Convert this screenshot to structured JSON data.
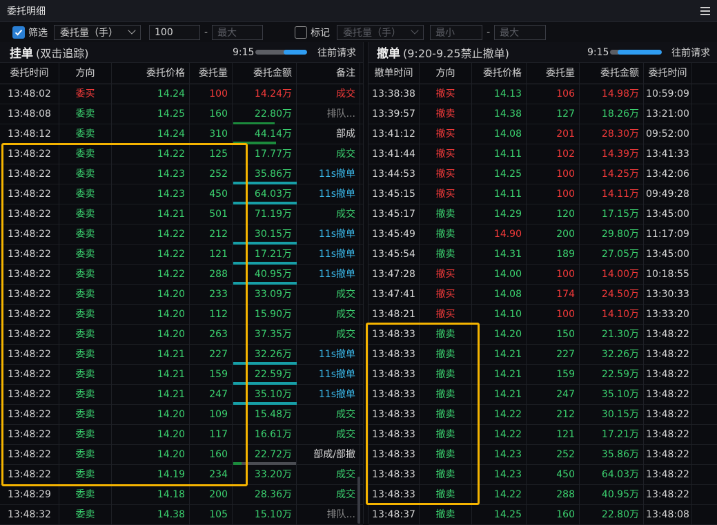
{
  "window": {
    "title": "委托明细",
    "menu_icon": "hamburger-menu-icon"
  },
  "filter": {
    "filter_checked": true,
    "filter_label": "筛选",
    "field_select": "委托量（手）",
    "min_value": "100",
    "dash": "-",
    "max_placeholder": "最大",
    "mark_checked": false,
    "mark_label": "标记",
    "mark_select": "委托量（手）",
    "mark_min_placeholder": "最小",
    "mark_max_placeholder": "最大"
  },
  "left": {
    "title": "挂单",
    "subtitle": "(双击追踪)",
    "time": "9:15",
    "progress": 0.45,
    "request": "往前请求",
    "columns": [
      "委托时间",
      "方向",
      "委托价格",
      "委托量",
      "委托金额",
      "备注"
    ],
    "rows": [
      {
        "time": "13:48:02",
        "dir": "委买",
        "price": "14.24",
        "vol": "100",
        "amt": "14.24万",
        "note": "成交",
        "dc": "red",
        "pc": "grn",
        "vc": "red",
        "ac": "red",
        "nc": "red",
        "bar": "none"
      },
      {
        "time": "13:48:08",
        "dir": "委卖",
        "price": "14.25",
        "vol": "160",
        "amt": "22.80万",
        "note": "排队...",
        "dc": "grn",
        "pc": "grn",
        "vc": "grn",
        "ac": "grn",
        "nc": "gray",
        "bar": "gray"
      },
      {
        "time": "13:48:12",
        "dir": "委卖",
        "price": "14.24",
        "vol": "310",
        "amt": "44.14万",
        "note": "部成",
        "dc": "grn",
        "pc": "grn",
        "vc": "grn",
        "ac": "grn",
        "nc": "wht",
        "bar": "green"
      },
      {
        "time": "13:48:22",
        "dir": "委卖",
        "price": "14.22",
        "vol": "125",
        "amt": "17.77万",
        "note": "成交",
        "dc": "grn",
        "pc": "grn",
        "vc": "grn",
        "ac": "grn",
        "nc": "grn",
        "bar": "none"
      },
      {
        "time": "13:48:22",
        "dir": "委卖",
        "price": "14.23",
        "vol": "252",
        "amt": "35.86万",
        "note": "11s撤单",
        "dc": "grn",
        "pc": "grn",
        "vc": "grn",
        "ac": "grn",
        "nc": "cyan",
        "bar": "teal"
      },
      {
        "time": "13:48:22",
        "dir": "委卖",
        "price": "14.23",
        "vol": "450",
        "amt": "64.03万",
        "note": "11s撤单",
        "dc": "grn",
        "pc": "grn",
        "vc": "grn",
        "ac": "grn",
        "nc": "cyan",
        "bar": "teal"
      },
      {
        "time": "13:48:22",
        "dir": "委卖",
        "price": "14.21",
        "vol": "501",
        "amt": "71.19万",
        "note": "成交",
        "dc": "grn",
        "pc": "grn",
        "vc": "grn",
        "ac": "grn",
        "nc": "grn",
        "bar": "none"
      },
      {
        "time": "13:48:22",
        "dir": "委卖",
        "price": "14.22",
        "vol": "212",
        "amt": "30.15万",
        "note": "11s撤单",
        "dc": "grn",
        "pc": "grn",
        "vc": "grn",
        "ac": "grn",
        "nc": "cyan",
        "bar": "teal"
      },
      {
        "time": "13:48:22",
        "dir": "委卖",
        "price": "14.22",
        "vol": "121",
        "amt": "17.21万",
        "note": "11s撤单",
        "dc": "grn",
        "pc": "grn",
        "vc": "grn",
        "ac": "grn",
        "nc": "cyan",
        "bar": "teal"
      },
      {
        "time": "13:48:22",
        "dir": "委卖",
        "price": "14.22",
        "vol": "288",
        "amt": "40.95万",
        "note": "11s撤单",
        "dc": "grn",
        "pc": "grn",
        "vc": "grn",
        "ac": "grn",
        "nc": "cyan",
        "bar": "teal"
      },
      {
        "time": "13:48:22",
        "dir": "委卖",
        "price": "14.20",
        "vol": "233",
        "amt": "33.09万",
        "note": "成交",
        "dc": "grn",
        "pc": "grn",
        "vc": "grn",
        "ac": "grn",
        "nc": "grn",
        "bar": "none"
      },
      {
        "time": "13:48:22",
        "dir": "委卖",
        "price": "14.20",
        "vol": "112",
        "amt": "15.90万",
        "note": "成交",
        "dc": "grn",
        "pc": "grn",
        "vc": "grn",
        "ac": "grn",
        "nc": "grn",
        "bar": "none"
      },
      {
        "time": "13:48:22",
        "dir": "委卖",
        "price": "14.20",
        "vol": "263",
        "amt": "37.35万",
        "note": "成交",
        "dc": "grn",
        "pc": "grn",
        "vc": "grn",
        "ac": "grn",
        "nc": "grn",
        "bar": "none"
      },
      {
        "time": "13:48:22",
        "dir": "委卖",
        "price": "14.21",
        "vol": "227",
        "amt": "32.26万",
        "note": "11s撤单",
        "dc": "grn",
        "pc": "grn",
        "vc": "grn",
        "ac": "grn",
        "nc": "cyan",
        "bar": "teal"
      },
      {
        "time": "13:48:22",
        "dir": "委卖",
        "price": "14.21",
        "vol": "159",
        "amt": "22.59万",
        "note": "11s撤单",
        "dc": "grn",
        "pc": "grn",
        "vc": "grn",
        "ac": "grn",
        "nc": "cyan",
        "bar": "teal"
      },
      {
        "time": "13:48:22",
        "dir": "委卖",
        "price": "14.21",
        "vol": "247",
        "amt": "35.10万",
        "note": "11s撤单",
        "dc": "grn",
        "pc": "grn",
        "vc": "grn",
        "ac": "grn",
        "nc": "cyan",
        "bar": "teal"
      },
      {
        "time": "13:48:22",
        "dir": "委卖",
        "price": "14.20",
        "vol": "109",
        "amt": "15.48万",
        "note": "成交",
        "dc": "grn",
        "pc": "grn",
        "vc": "grn",
        "ac": "grn",
        "nc": "grn",
        "bar": "none"
      },
      {
        "time": "13:48:22",
        "dir": "委卖",
        "price": "14.20",
        "vol": "117",
        "amt": "16.61万",
        "note": "成交",
        "dc": "grn",
        "pc": "grn",
        "vc": "grn",
        "ac": "grn",
        "nc": "grn",
        "bar": "none"
      },
      {
        "time": "13:48:22",
        "dir": "委卖",
        "price": "14.20",
        "vol": "160",
        "amt": "22.72万",
        "note": "部成/部撤",
        "dc": "grn",
        "pc": "grn",
        "vc": "grn",
        "ac": "grn",
        "nc": "wht",
        "bar": "mixed"
      },
      {
        "time": "13:48:22",
        "dir": "委卖",
        "price": "14.19",
        "vol": "234",
        "amt": "33.20万",
        "note": "成交",
        "dc": "grn",
        "pc": "grn",
        "vc": "grn",
        "ac": "grn",
        "nc": "grn",
        "bar": "none"
      },
      {
        "time": "13:48:29",
        "dir": "委卖",
        "price": "14.18",
        "vol": "200",
        "amt": "28.36万",
        "note": "成交",
        "dc": "grn",
        "pc": "grn",
        "vc": "grn",
        "ac": "grn",
        "nc": "grn",
        "bar": "none"
      },
      {
        "time": "13:48:32",
        "dir": "委卖",
        "price": "14.38",
        "vol": "105",
        "amt": "15.10万",
        "note": "排队...",
        "dc": "grn",
        "pc": "grn",
        "vc": "grn",
        "ac": "grn",
        "nc": "gray",
        "bar": "none"
      }
    ]
  },
  "right": {
    "title": "撤单",
    "subtitle": "(9:20-9.25禁止撤单)",
    "time": "9:15",
    "progress": 0.85,
    "request": "往前请求",
    "columns": [
      "撤单时间",
      "方向",
      "委托价格",
      "委托量",
      "委托金额",
      "委托时间"
    ],
    "rows": [
      {
        "time": "13:38:38",
        "dir": "撤买",
        "price": "14.13",
        "vol": "106",
        "amt": "14.98万",
        "otime": "10:59:09",
        "dc": "red",
        "pc": "grn",
        "vc": "red",
        "ac": "red"
      },
      {
        "time": "13:39:57",
        "dir": "撤卖",
        "price": "14.38",
        "vol": "127",
        "amt": "18.26万",
        "otime": "13:21:00",
        "dc": "red",
        "pc": "grn",
        "vc": "grn",
        "ac": "grn"
      },
      {
        "time": "13:41:12",
        "dir": "撤买",
        "price": "14.08",
        "vol": "201",
        "amt": "28.30万",
        "otime": "09:52:00",
        "dc": "red",
        "pc": "grn",
        "vc": "red",
        "ac": "red"
      },
      {
        "time": "13:41:44",
        "dir": "撤买",
        "price": "14.11",
        "vol": "102",
        "amt": "14.39万",
        "otime": "13:41:33",
        "dc": "red",
        "pc": "grn",
        "vc": "red",
        "ac": "red"
      },
      {
        "time": "13:44:53",
        "dir": "撤买",
        "price": "14.25",
        "vol": "100",
        "amt": "14.25万",
        "otime": "13:42:06",
        "dc": "red",
        "pc": "grn",
        "vc": "red",
        "ac": "red"
      },
      {
        "time": "13:45:15",
        "dir": "撤买",
        "price": "14.11",
        "vol": "100",
        "amt": "14.11万",
        "otime": "09:49:28",
        "dc": "red",
        "pc": "grn",
        "vc": "red",
        "ac": "red"
      },
      {
        "time": "13:45:17",
        "dir": "撤卖",
        "price": "14.29",
        "vol": "120",
        "amt": "17.15万",
        "otime": "13:45:00",
        "dc": "grn",
        "pc": "grn",
        "vc": "grn",
        "ac": "grn"
      },
      {
        "time": "13:45:49",
        "dir": "撤卖",
        "price": "14.90",
        "vol": "200",
        "amt": "29.80万",
        "otime": "11:17:09",
        "dc": "grn",
        "pc": "red",
        "vc": "grn",
        "ac": "grn"
      },
      {
        "time": "13:45:54",
        "dir": "撤卖",
        "price": "14.31",
        "vol": "189",
        "amt": "27.05万",
        "otime": "13:45:00",
        "dc": "grn",
        "pc": "grn",
        "vc": "grn",
        "ac": "grn"
      },
      {
        "time": "13:47:28",
        "dir": "撤买",
        "price": "14.00",
        "vol": "100",
        "amt": "14.00万",
        "otime": "10:18:55",
        "dc": "red",
        "pc": "grn",
        "vc": "red",
        "ac": "red"
      },
      {
        "time": "13:47:41",
        "dir": "撤买",
        "price": "14.08",
        "vol": "174",
        "amt": "24.50万",
        "otime": "13:30:33",
        "dc": "red",
        "pc": "grn",
        "vc": "red",
        "ac": "red"
      },
      {
        "time": "13:48:21",
        "dir": "撤买",
        "price": "14.10",
        "vol": "100",
        "amt": "14.10万",
        "otime": "13:33:20",
        "dc": "red",
        "pc": "grn",
        "vc": "red",
        "ac": "red"
      },
      {
        "time": "13:48:33",
        "dir": "撤卖",
        "price": "14.20",
        "vol": "150",
        "amt": "21.30万",
        "otime": "13:48:22",
        "dc": "grn",
        "pc": "grn",
        "vc": "grn",
        "ac": "grn"
      },
      {
        "time": "13:48:33",
        "dir": "撤卖",
        "price": "14.21",
        "vol": "227",
        "amt": "32.26万",
        "otime": "13:48:22",
        "dc": "grn",
        "pc": "grn",
        "vc": "grn",
        "ac": "grn"
      },
      {
        "time": "13:48:33",
        "dir": "撤卖",
        "price": "14.21",
        "vol": "159",
        "amt": "22.59万",
        "otime": "13:48:22",
        "dc": "grn",
        "pc": "grn",
        "vc": "grn",
        "ac": "grn"
      },
      {
        "time": "13:48:33",
        "dir": "撤卖",
        "price": "14.21",
        "vol": "247",
        "amt": "35.10万",
        "otime": "13:48:22",
        "dc": "grn",
        "pc": "grn",
        "vc": "grn",
        "ac": "grn"
      },
      {
        "time": "13:48:33",
        "dir": "撤卖",
        "price": "14.22",
        "vol": "212",
        "amt": "30.15万",
        "otime": "13:48:22",
        "dc": "grn",
        "pc": "grn",
        "vc": "grn",
        "ac": "grn"
      },
      {
        "time": "13:48:33",
        "dir": "撤卖",
        "price": "14.22",
        "vol": "121",
        "amt": "17.21万",
        "otime": "13:48:22",
        "dc": "grn",
        "pc": "grn",
        "vc": "grn",
        "ac": "grn"
      },
      {
        "time": "13:48:33",
        "dir": "撤卖",
        "price": "14.23",
        "vol": "252",
        "amt": "35.86万",
        "otime": "13:48:22",
        "dc": "grn",
        "pc": "grn",
        "vc": "grn",
        "ac": "grn"
      },
      {
        "time": "13:48:33",
        "dir": "撤卖",
        "price": "14.23",
        "vol": "450",
        "amt": "64.03万",
        "otime": "13:48:22",
        "dc": "grn",
        "pc": "grn",
        "vc": "grn",
        "ac": "grn"
      },
      {
        "time": "13:48:33",
        "dir": "撤卖",
        "price": "14.22",
        "vol": "288",
        "amt": "40.95万",
        "otime": "13:48:22",
        "dc": "grn",
        "pc": "grn",
        "vc": "grn",
        "ac": "grn"
      },
      {
        "time": "13:48:37",
        "dir": "撤卖",
        "price": "14.25",
        "vol": "160",
        "amt": "22.80万",
        "otime": "13:48:08",
        "dc": "grn",
        "pc": "grn",
        "vc": "grn",
        "ac": "grn"
      }
    ]
  },
  "colors": {
    "buy": "#f33a3a",
    "sell": "#3bd16f",
    "cancel_note": "#3ab7e8",
    "highlight": "#f5b400",
    "progress": "#2f9df2"
  }
}
